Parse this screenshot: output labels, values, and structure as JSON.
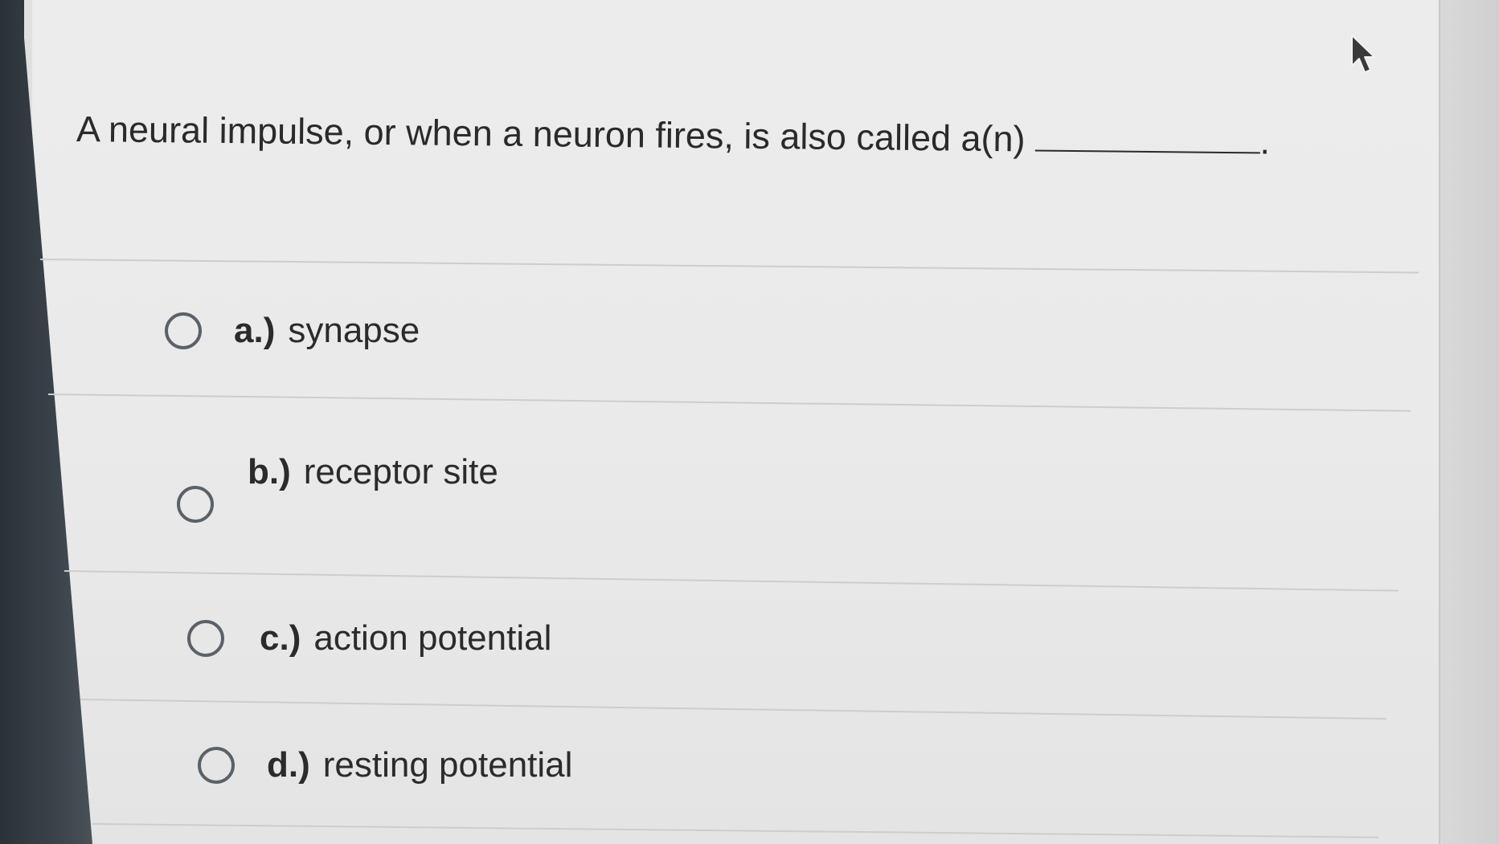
{
  "question": {
    "text": "A neural impulse, or when a neuron fires, is also called a(n)",
    "end_punct": "."
  },
  "options": [
    {
      "letter": "a.)",
      "label": "synapse"
    },
    {
      "letter": "b.)",
      "label": "receptor site"
    },
    {
      "letter": "c.)",
      "label": "action potential"
    },
    {
      "letter": "d.)",
      "label": "resting potential"
    }
  ],
  "icons": {
    "cursor": "mouse-pointer-icon",
    "radio": "radio-circle-icon"
  },
  "colors": {
    "text": "#2a2a2a",
    "radio_border": "#5b6168",
    "divider": "#cdcdcd",
    "sidebar": "#2b3237"
  }
}
